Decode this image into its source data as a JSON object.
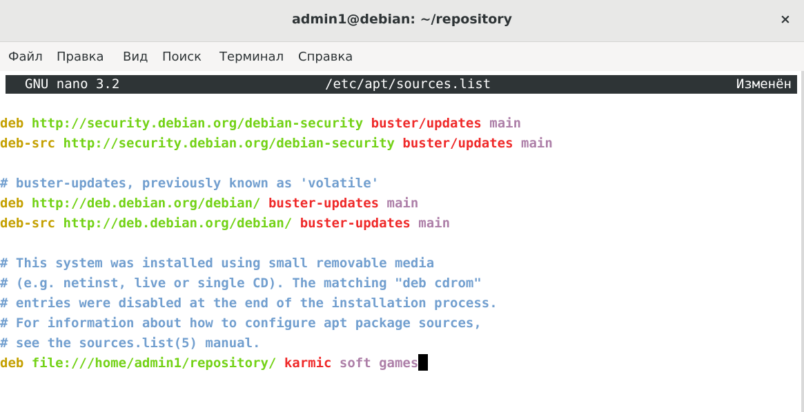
{
  "window": {
    "title": "admin1@debian: ~/repository",
    "close_glyph": "×"
  },
  "menu": {
    "items": [
      "Файл",
      "Правка",
      "Вид",
      "Поиск",
      "Терминал",
      "Справка"
    ]
  },
  "nano": {
    "version": "GNU nano 3.2",
    "filename": "/etc/apt/sources.list",
    "status": "Изменён"
  },
  "colors": {
    "keyword": "#c4a000",
    "url": "#73d216",
    "suite": "#ef2929",
    "component": "#ad7fa8",
    "comment": "#729fcf",
    "header_bg": "#2e3436"
  },
  "lines": [
    [
      {
        "t": "deb ",
        "c": "keyword"
      },
      {
        "t": "http://security.debian.org/debian-security ",
        "c": "url"
      },
      {
        "t": "buster/updates",
        "c": "suite"
      },
      {
        "t": " main",
        "c": "component"
      }
    ],
    [
      {
        "t": "deb-src ",
        "c": "keyword"
      },
      {
        "t": "http://security.debian.org/debian-security ",
        "c": "url"
      },
      {
        "t": "buster/updates",
        "c": "suite"
      },
      {
        "t": " main",
        "c": "component"
      }
    ],
    [],
    [
      {
        "t": "# buster-updates, previously known as 'volatile'",
        "c": "comment"
      }
    ],
    [
      {
        "t": "deb ",
        "c": "keyword"
      },
      {
        "t": "http://deb.debian.org/debian/ ",
        "c": "url"
      },
      {
        "t": "buster-updates",
        "c": "suite"
      },
      {
        "t": " main",
        "c": "component"
      }
    ],
    [
      {
        "t": "deb-src ",
        "c": "keyword"
      },
      {
        "t": "http://deb.debian.org/debian/ ",
        "c": "url"
      },
      {
        "t": "buster-updates",
        "c": "suite"
      },
      {
        "t": " main",
        "c": "component"
      }
    ],
    [],
    [
      {
        "t": "# This system was installed using small removable media",
        "c": "comment"
      }
    ],
    [
      {
        "t": "# (e.g. netinst, live or single CD). The matching \"deb cdrom\"",
        "c": "comment"
      }
    ],
    [
      {
        "t": "# entries were disabled at the end of the installation process.",
        "c": "comment"
      }
    ],
    [
      {
        "t": "# For information about how to configure apt package sources,",
        "c": "comment"
      }
    ],
    [
      {
        "t": "# see the sources.list(5) manual.",
        "c": "comment"
      }
    ],
    [
      {
        "t": "deb ",
        "c": "keyword"
      },
      {
        "t": "file:///home/admin1/repository/ ",
        "c": "url"
      },
      {
        "t": "karmic",
        "c": "suite"
      },
      {
        "t": " soft games",
        "c": "component"
      }
    ]
  ],
  "cursor_line": 12
}
